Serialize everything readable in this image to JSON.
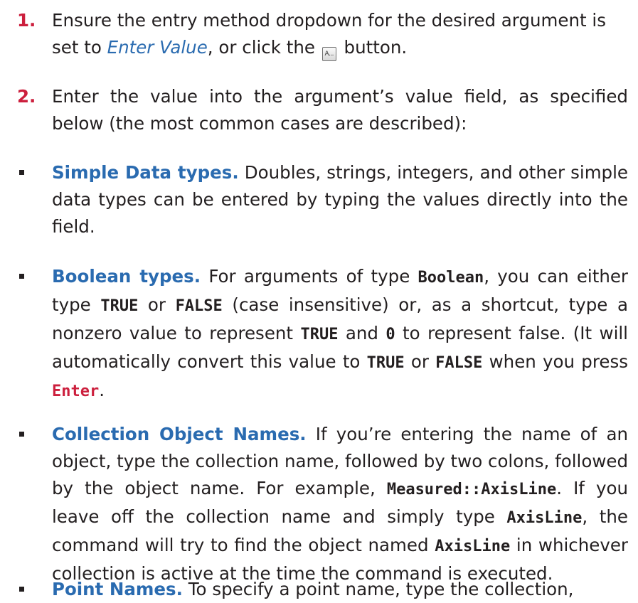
{
  "steps": [
    {
      "number": "1.",
      "text_a": "Ensure the entry method dropdown for the desired argument is set to ",
      "link": "Enter Value",
      "text_b": ", or click the ",
      "icon": "value-entry-button-icon",
      "text_c": " button."
    },
    {
      "number": "2.",
      "text": "Enter the value into the argument’s value field, as specified below (the most common cases are described):"
    }
  ],
  "bullets": {
    "simple": {
      "term": "Simple Data types.",
      "text": " Doubles, strings, integers, and other simple data types can be entered by typing the values directly into the field."
    },
    "boolean": {
      "term": "Boolean types.",
      "t1": " For arguments of type ",
      "c1": "Boolean",
      "t2": ", you can either type ",
      "c2": "TRUE",
      "t3": " or ",
      "c3": "FALSE",
      "t4": " (case insensitive) or, as a shortcut, type a nonzero value to represent ",
      "c4": "TRUE",
      "t5": " and ",
      "c5": "0",
      "t6": " to represent false. (It will automatically convert this value to ",
      "c6": "TRUE",
      "t7": " or ",
      "c7": "FALSE",
      "t8": " when you press ",
      "key": "Enter",
      "t9": "."
    },
    "collection": {
      "term": "Collection Object Names.",
      "t1": " If you’re entering the name of an object, type the collection name, followed by two colons, followed by the object name. For example, ",
      "c1": "Measured::AxisLine",
      "t2": ". If you leave off the collection name and simply type ",
      "c2": "AxisLine",
      "t3": ", the command will try to find the object named ",
      "c3": "AxisLine",
      "t4": " in whichever collection is active at the time the command is executed."
    },
    "point": {
      "term": "Point Names.",
      "text": " To specify a point name, type the collection,"
    }
  },
  "colors": {
    "accent_red": "#cc1f3d",
    "accent_blue": "#2a6bb0",
    "text": "#231f20"
  }
}
